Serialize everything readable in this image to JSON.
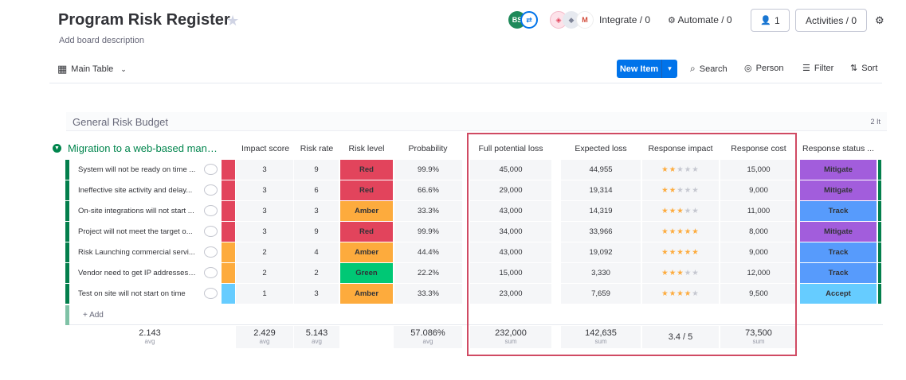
{
  "header": {
    "title": "Program Risk Register",
    "description": "Add board description",
    "avatar_initials": "BS",
    "integrate": "Integrate / 0",
    "automate": "Automate / 0",
    "members": "1",
    "activities": "Activities / 0"
  },
  "toolbar": {
    "view": "Main Table",
    "new_item": "New Item",
    "search": "Search",
    "person": "Person",
    "filter": "Filter",
    "sort": "Sort"
  },
  "group_above": {
    "title": "General Risk Budget",
    "count": "2 It"
  },
  "group": {
    "title": "Migration to a web-based mana..."
  },
  "columns": {
    "impact_score": "Impact score",
    "risk_rate": "Risk rate",
    "risk_level": "Risk level",
    "probability": "Probability",
    "full_loss": "Full potential loss",
    "expected_loss": "Expected loss",
    "response_impact": "Response impact",
    "response_cost": "Response cost",
    "response_status": "Response status ..."
  },
  "colors": {
    "Red": "#e2445c",
    "Amber": "#fdab3d",
    "Green": "#00c875",
    "Mitigate": "#a25ddc",
    "Track": "#579bfc",
    "Accept": "#66ccff",
    "pri_red": "#e2445c",
    "pri_orange": "#fdab3d",
    "pri_blue": "#66ccff"
  },
  "rows": [
    {
      "name": "System will not be ready on time ...",
      "pri": "pri_red",
      "impact": "3",
      "rate": "9",
      "level": "Red",
      "prob": "99.9%",
      "full": "45,000",
      "expected": "44,955",
      "stars": 2,
      "cost": "15,000",
      "status": "Mitigate"
    },
    {
      "name": "Ineffective site activity and delay...",
      "pri": "pri_red",
      "impact": "3",
      "rate": "6",
      "level": "Red",
      "prob": "66.6%",
      "full": "29,000",
      "expected": "19,314",
      "stars": 2,
      "cost": "9,000",
      "status": "Mitigate"
    },
    {
      "name": "On-site integrations will not start ...",
      "pri": "pri_red",
      "impact": "3",
      "rate": "3",
      "level": "Amber",
      "prob": "33.3%",
      "full": "43,000",
      "expected": "14,319",
      "stars": 3,
      "cost": "11,000",
      "status": "Track"
    },
    {
      "name": "Project will not meet the target o...",
      "pri": "pri_red",
      "impact": "3",
      "rate": "9",
      "level": "Red",
      "prob": "99.9%",
      "full": "34,000",
      "expected": "33,966",
      "stars": 5,
      "cost": "8,000",
      "status": "Mitigate"
    },
    {
      "name": "Risk Launching commercial servi...",
      "pri": "pri_orange",
      "impact": "2",
      "rate": "4",
      "level": "Amber",
      "prob": "44.4%",
      "full": "43,000",
      "expected": "19,092",
      "stars": 5,
      "cost": "9,000",
      "status": "Track"
    },
    {
      "name": "Vendor need to get IP addresses ...",
      "pri": "pri_orange",
      "impact": "2",
      "rate": "2",
      "level": "Green",
      "prob": "22.2%",
      "full": "15,000",
      "expected": "3,330",
      "stars": 3,
      "cost": "12,000",
      "status": "Track"
    },
    {
      "name": "Test on site will not start on time",
      "pri": "pri_blue",
      "impact": "1",
      "rate": "3",
      "level": "Amber",
      "prob": "33.3%",
      "full": "23,000",
      "expected": "7,659",
      "stars": 4,
      "cost": "9,500",
      "status": "Accept"
    }
  ],
  "add_item": "+ Add",
  "summary": {
    "first": {
      "value": "2.143",
      "unit": "avg"
    },
    "impact": {
      "value": "2.429",
      "unit": "avg"
    },
    "rate": {
      "value": "5.143",
      "unit": "avg"
    },
    "prob": {
      "value": "57.086%",
      "unit": "avg"
    },
    "full": {
      "value": "232,000",
      "unit": "sum"
    },
    "expected": {
      "value": "142,635",
      "unit": "sum"
    },
    "response_impact": "3.4 / 5",
    "cost": {
      "value": "73,500",
      "unit": "sum"
    }
  }
}
